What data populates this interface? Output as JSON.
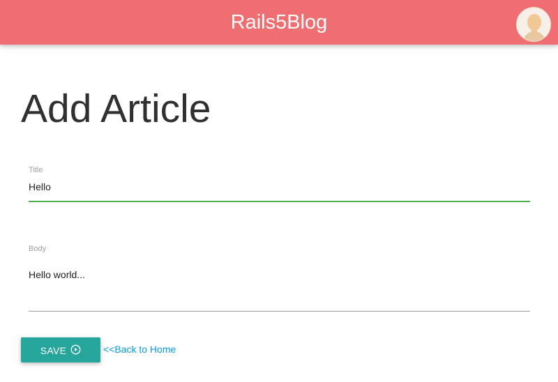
{
  "header": {
    "brand": "Rails5Blog",
    "avatar_icon": "user-avatar-icon",
    "background_color": "#ef6e72"
  },
  "main": {
    "page_title": "Add Article",
    "title_field": {
      "label": "Title",
      "value": "Hello",
      "underline_color": "#4caf50"
    },
    "body_field": {
      "label": "Body",
      "value": "Hello world..."
    },
    "save_button": {
      "label": "Save",
      "icon": "play-circle-icon",
      "color": "#26a69a"
    },
    "back_link": "<<Back to Home"
  }
}
